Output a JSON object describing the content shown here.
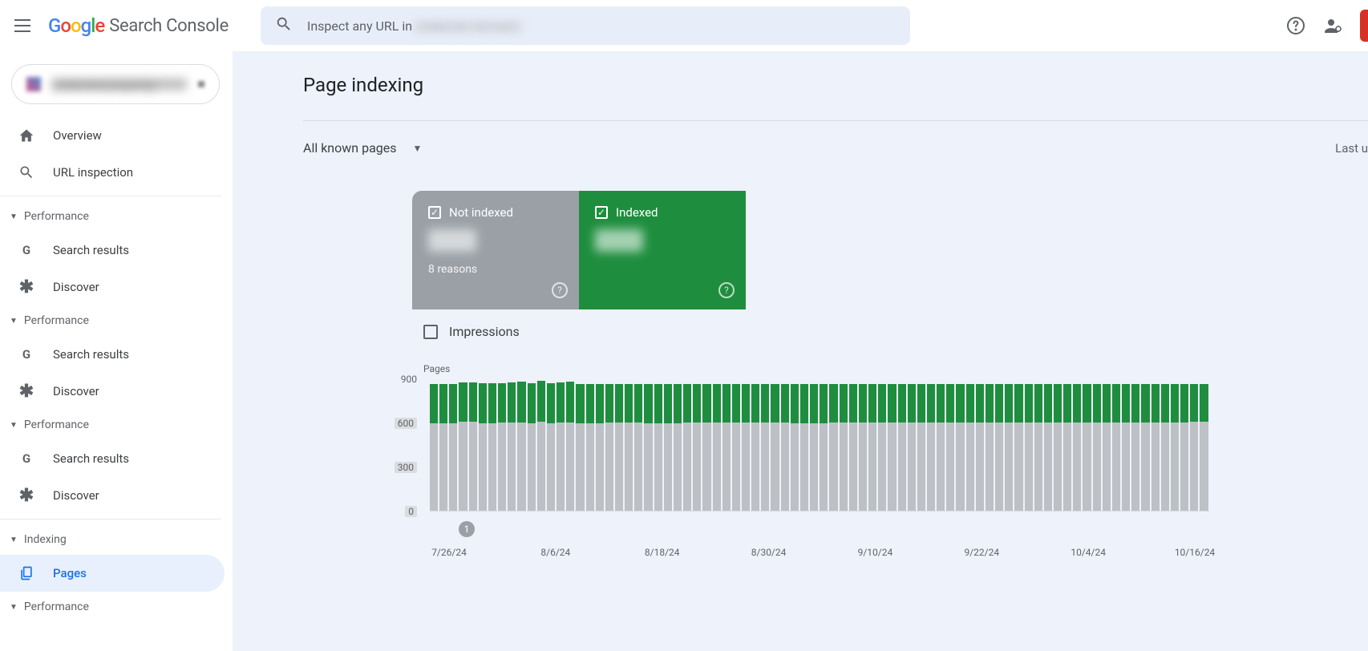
{
  "header": {
    "product_name": "Search Console",
    "search_placeholder_prefix": "Inspect any URL in ",
    "search_placeholder_domain": "(redacted domain)"
  },
  "sidebar": {
    "property_name": "(redacted property)",
    "items": [
      {
        "icon": "home",
        "label": "Overview"
      },
      {
        "icon": "search",
        "label": "URL inspection"
      }
    ],
    "sections": [
      {
        "title": "Performance",
        "items": [
          {
            "icon": "G",
            "label": "Search results"
          },
          {
            "icon": "asterisk",
            "label": "Discover"
          }
        ]
      },
      {
        "title": "Performance",
        "items": [
          {
            "icon": "G",
            "label": "Search results"
          },
          {
            "icon": "asterisk",
            "label": "Discover"
          }
        ]
      },
      {
        "title": "Performance",
        "items": [
          {
            "icon": "G",
            "label": "Search results"
          },
          {
            "icon": "asterisk",
            "label": "Discover"
          }
        ]
      },
      {
        "title": "Indexing",
        "items": [
          {
            "icon": "pages",
            "label": "Pages",
            "selected": true
          }
        ]
      },
      {
        "title": "Performance",
        "items": []
      }
    ]
  },
  "main": {
    "page_title": "Page indexing",
    "filter_label": "All known pages",
    "last_updated_prefix": "Last u"
  },
  "cards": {
    "not_indexed": {
      "title": "Not indexed",
      "value": "(redacted)",
      "subtitle": "8 reasons",
      "checked": true
    },
    "indexed": {
      "title": "Indexed",
      "value": "(redacted)",
      "checked": true
    }
  },
  "impressions_label": "Impressions",
  "chart_data": {
    "type": "bar",
    "title": "",
    "ylabel": "Pages",
    "ylim": [
      0,
      900
    ],
    "yticks": [
      0,
      300,
      600,
      900
    ],
    "yticks_highlight": [
      0,
      300,
      600
    ],
    "x_tick_labels": [
      "7/26/24",
      "8/6/24",
      "8/18/24",
      "8/30/24",
      "9/10/24",
      "9/22/24",
      "10/4/24",
      "10/16/24"
    ],
    "annotation": {
      "index": 3,
      "label": "1"
    },
    "series": [
      {
        "name": "Not indexed",
        "color": "#bdc1c6",
        "values": [
          600,
          600,
          600,
          610,
          610,
          600,
          600,
          605,
          605,
          605,
          600,
          610,
          600,
          605,
          605,
          600,
          600,
          600,
          605,
          605,
          605,
          605,
          600,
          600,
          600,
          600,
          605,
          605,
          605,
          605,
          605,
          605,
          605,
          605,
          605,
          605,
          605,
          600,
          600,
          600,
          600,
          605,
          605,
          605,
          605,
          605,
          605,
          605,
          605,
          605,
          605,
          605,
          605,
          605,
          605,
          605,
          605,
          605,
          605,
          605,
          605,
          605,
          605,
          605,
          605,
          605,
          605,
          605,
          605,
          605,
          605,
          605,
          605,
          605,
          605,
          605,
          605,
          605,
          610,
          610
        ]
      },
      {
        "name": "Indexed",
        "color": "#1e8e3e",
        "values": [
          270,
          270,
          265,
          270,
          270,
          275,
          275,
          270,
          275,
          280,
          275,
          280,
          275,
          275,
          280,
          270,
          270,
          265,
          265,
          265,
          265,
          265,
          265,
          265,
          265,
          265,
          260,
          260,
          265,
          265,
          260,
          260,
          260,
          260,
          260,
          260,
          260,
          265,
          265,
          265,
          265,
          260,
          260,
          260,
          260,
          260,
          260,
          260,
          260,
          260,
          260,
          260,
          260,
          260,
          260,
          260,
          260,
          260,
          260,
          260,
          260,
          260,
          260,
          260,
          260,
          260,
          260,
          260,
          260,
          260,
          260,
          260,
          260,
          260,
          260,
          260,
          260,
          260,
          260,
          260
        ]
      }
    ]
  }
}
